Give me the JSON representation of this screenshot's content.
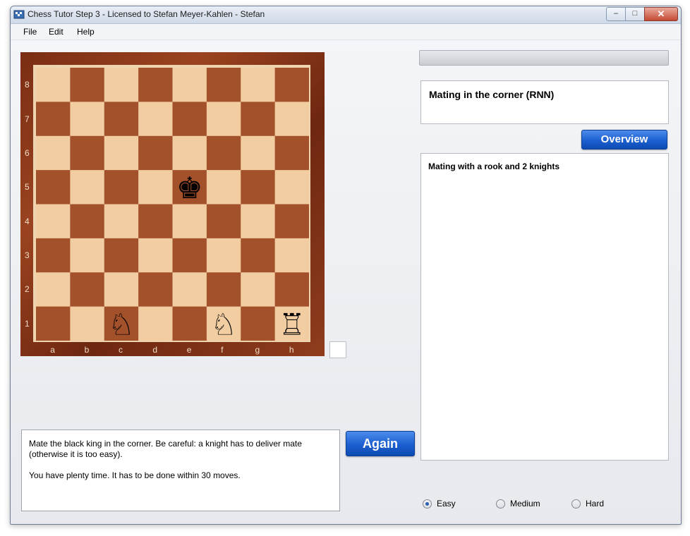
{
  "window": {
    "title": "Chess Tutor Step 3 - Licensed to Stefan Meyer-Kahlen - Stefan",
    "controls": {
      "minimize": "–",
      "maximize": "□",
      "close": "✕"
    }
  },
  "menu": {
    "items": [
      "File",
      "Edit",
      "Help"
    ]
  },
  "board": {
    "ranks": [
      "8",
      "7",
      "6",
      "5",
      "4",
      "3",
      "2",
      "1"
    ],
    "files": [
      "a",
      "b",
      "c",
      "d",
      "e",
      "f",
      "g",
      "h"
    ],
    "pieces": [
      {
        "square": "e5",
        "piece": "king",
        "color": "black",
        "glyph": "♚"
      },
      {
        "square": "c1",
        "piece": "knight",
        "color": "white",
        "glyph": "♘"
      },
      {
        "square": "f1",
        "piece": "knight",
        "color": "white",
        "glyph": "♘"
      },
      {
        "square": "h1",
        "piece": "rook",
        "color": "white",
        "glyph": "♖"
      }
    ],
    "light_square": "#f2cda2",
    "dark_square": "#a3512a"
  },
  "lesson": {
    "title": "Mating in the corner (RNN)",
    "overview_label": "Overview",
    "description": "Mating with a rook and 2 knights"
  },
  "instructions": {
    "lines": [
      "Mate the black king in the corner. Be careful: a knight has to deliver mate",
      "(otherwise it is too easy).",
      "",
      "You have plenty time. It has to be done within 30 moves."
    ],
    "again_label": "Again"
  },
  "difficulty": {
    "options": [
      "Easy",
      "Medium",
      "Hard"
    ],
    "selected": "Easy"
  },
  "colors": {
    "accent_button": "#1b5fd0",
    "board_frame": "#7a2d13"
  }
}
